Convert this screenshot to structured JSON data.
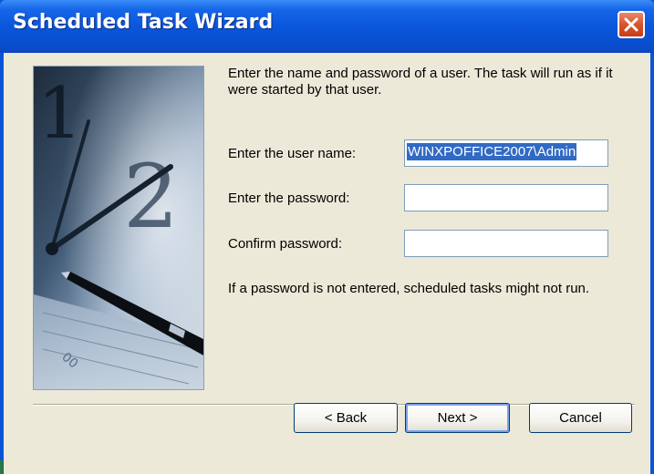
{
  "window": {
    "title": "Scheduled Task Wizard",
    "close_icon": "close-icon"
  },
  "content": {
    "intro": "Enter the name and password of a user.  The task will run as if it were started by that user.",
    "user_name_label": "Enter the user name:",
    "user_name_value": "WINXPOFFICE2007\\Admin",
    "password_label": "Enter the password:",
    "password_value": "",
    "confirm_label": "Confirm password:",
    "confirm_value": "",
    "note": "If a password is not entered, scheduled tasks might not run."
  },
  "buttons": {
    "back": "< Back",
    "next": "Next >",
    "cancel": "Cancel"
  },
  "colors": {
    "titlebar": "#0a56dc",
    "dialog_background": "#ece9d8",
    "selection": "#316ac5",
    "close_button": "#d9532c"
  }
}
